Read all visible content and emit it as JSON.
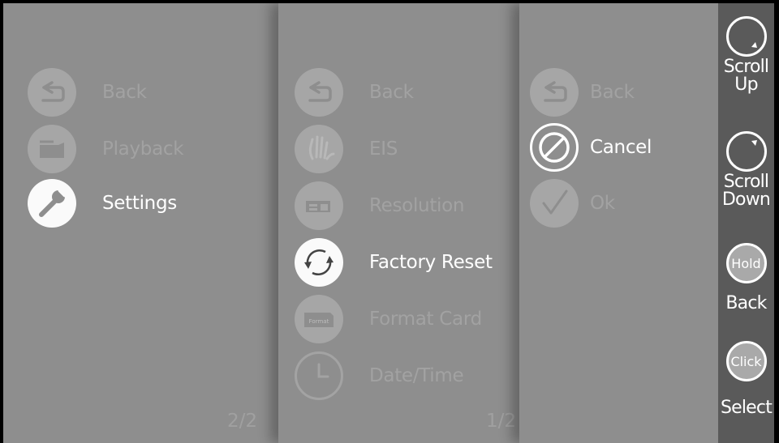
{
  "panel1": {
    "items": [
      {
        "label": "Back",
        "icon": "back-icon",
        "active": false
      },
      {
        "label": "Playback",
        "icon": "folder-icon",
        "active": false
      },
      {
        "label": "Settings",
        "icon": "wrench-icon",
        "active": true
      }
    ],
    "page": "2/2"
  },
  "panel2": {
    "items": [
      {
        "label": "Back",
        "icon": "back-icon",
        "active": false
      },
      {
        "label": "EIS",
        "icon": "hand-shake-icon",
        "active": false
      },
      {
        "label": "Resolution",
        "icon": "resolution-icon",
        "active": false
      },
      {
        "label": "Factory Reset",
        "icon": "reset-arrows-icon",
        "active": true
      },
      {
        "label": "Format Card",
        "icon": "format-card-icon",
        "icon_text": "Format",
        "active": false
      },
      {
        "label": "Date/Time",
        "icon": "clock-icon",
        "active": false
      }
    ],
    "page": "1/2"
  },
  "panel3": {
    "items": [
      {
        "label": "Back",
        "icon": "back-icon",
        "active": false
      },
      {
        "label": "Cancel",
        "icon": "cancel-icon",
        "active": true
      },
      {
        "label": "Ok",
        "icon": "check-icon",
        "active": false
      }
    ]
  },
  "sidebar": {
    "scroll_up": "Scroll\nUp",
    "scroll_down": "Scroll\nDown",
    "hold_icon": "Hold",
    "back": "Back",
    "click_icon": "Click",
    "select": "Select"
  },
  "colors": {
    "background": "#8e8e8e",
    "sidebar": "#5a5a5a",
    "active_text": "#ffffff",
    "inactive_text": "#a2a2a2"
  }
}
